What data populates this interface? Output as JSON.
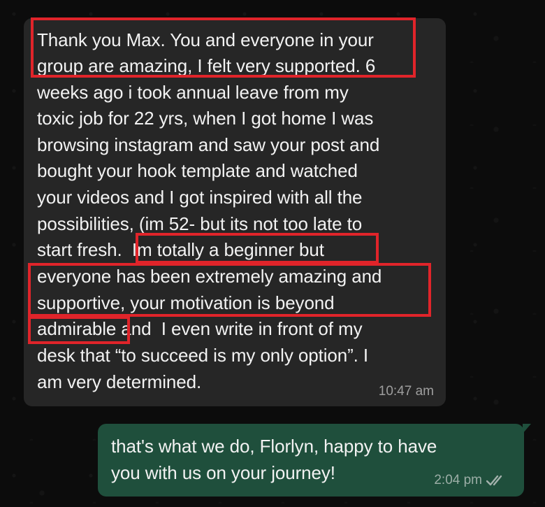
{
  "incoming_message": {
    "lines": [
      "Thank you Max. You and everyone in your",
      "group are amazing, I felt very supported. 6",
      "weeks ago i took annual leave from my",
      "toxic job for 22 yrs, when I got home I was",
      "browsing instagram and saw your post and",
      "bought your hook template and watched",
      "your videos and I got inspired with all the",
      "possibilities, (im 52- but its not too late to",
      "start fresh.  Im totally a beginner but",
      "everyone has been extremely amazing and",
      "supportive, your motivation is beyond",
      "admirable and  I even write in front of my",
      "desk that “to succeed is my only option”. I",
      "am very determined."
    ],
    "time": "10:47 am"
  },
  "outgoing_message": {
    "lines": [
      "that's what we do, Florlyn, happy to have",
      "you with us on your journey!"
    ],
    "time": "2:04 pm",
    "status_icon": "double-check-read-icon"
  },
  "colors": {
    "incoming_bubble": "#262626",
    "outgoing_bubble": "#1f4f3c",
    "highlight": "#e0242a",
    "text": "#f2f2f2"
  }
}
